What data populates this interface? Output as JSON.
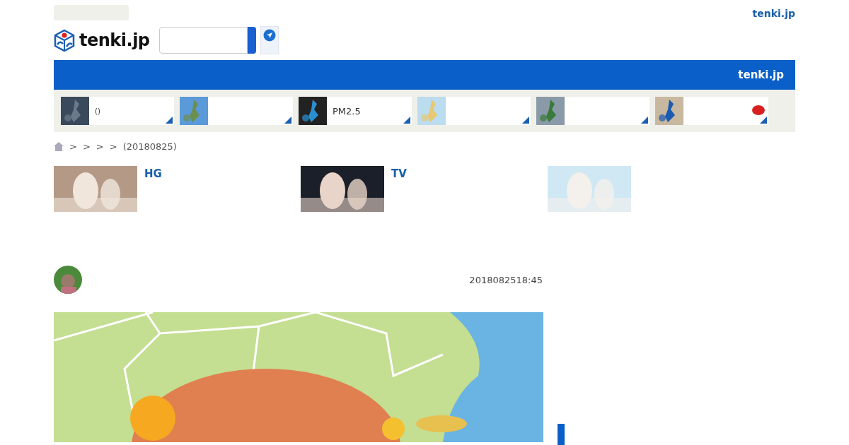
{
  "header": {
    "top_link": "tenki.jp",
    "logo": "tenki.jp",
    "banner_title": "tenki.jp"
  },
  "nav_tiles": [
    {
      "label": "()",
      "badge": false
    },
    {
      "badge": false
    },
    {
      "label": "PM2.5",
      "badge": false
    },
    {
      "badge": false
    },
    {
      "badge": false
    },
    {
      "badge": true
    }
  ],
  "breadcrumb": [
    ">",
    ">",
    ">",
    ">",
    "(20180825)"
  ],
  "ads": [
    {
      "kind": "picture",
      "title": "HG"
    },
    {
      "kind": "picture",
      "title": "TV"
    },
    {
      "kind": "picture"
    }
  ],
  "article": {
    "date": "2018082518:45"
  }
}
